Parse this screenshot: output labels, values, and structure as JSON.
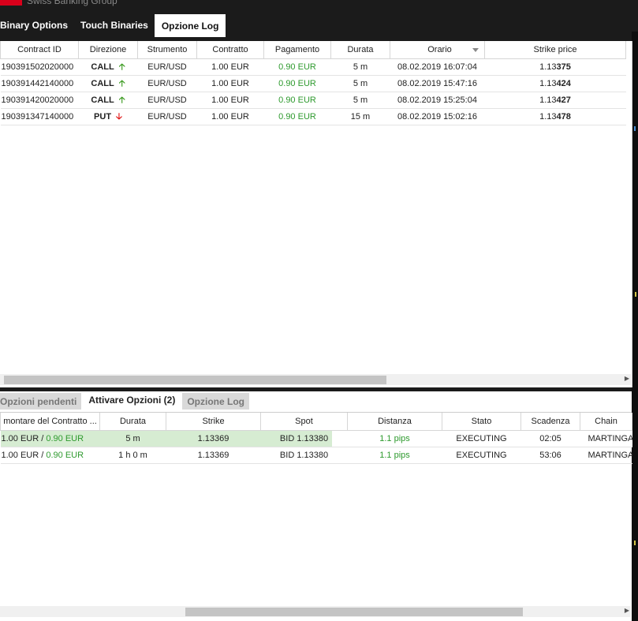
{
  "header": {
    "brand_text": "Swiss Banking Group",
    "tabs": [
      {
        "label": "Binary Options"
      },
      {
        "label": "Touch Binaries"
      },
      {
        "label": "Opzione Log"
      }
    ]
  },
  "log_table": {
    "columns": [
      "Contract ID",
      "Direzione",
      "Strumento",
      "Contratto",
      "Pagamento",
      "Durata",
      "Orario",
      "Strike price"
    ],
    "rows": [
      {
        "id": "190391502020000",
        "dir": "CALL",
        "instrument": "EUR/USD",
        "contract": "1.00 EUR",
        "payment": "0.90 EUR",
        "duration": "5 m",
        "time": "08.02.2019 16:07:04",
        "strike_a": "1.13",
        "strike_b": "375"
      },
      {
        "id": "190391442140000",
        "dir": "CALL",
        "instrument": "EUR/USD",
        "contract": "1.00 EUR",
        "payment": "0.90 EUR",
        "duration": "5 m",
        "time": "08.02.2019 15:47:16",
        "strike_a": "1.13",
        "strike_b": "424"
      },
      {
        "id": "190391420020000",
        "dir": "CALL",
        "instrument": "EUR/USD",
        "contract": "1.00 EUR",
        "payment": "0.90 EUR",
        "duration": "5 m",
        "time": "08.02.2019 15:25:04",
        "strike_a": "1.13",
        "strike_b": "427"
      },
      {
        "id": "190391347140000",
        "dir": "PUT",
        "instrument": "EUR/USD",
        "contract": "1.00 EUR",
        "payment": "0.90 EUR",
        "duration": "15 m",
        "time": "08.02.2019 15:02:16",
        "strike_a": "1.13",
        "strike_b": "478"
      }
    ]
  },
  "sub_tabs": [
    {
      "label": "Opzioni pendenti"
    },
    {
      "label": "Attivare Opzioni (2)"
    },
    {
      "label": "Opzione Log"
    }
  ],
  "active_table": {
    "columns": [
      "montare del Contratto ...",
      "Durata",
      "Strike",
      "Spot",
      "Distanza",
      "Stato",
      "Scadenza",
      "Chain"
    ],
    "rows": [
      {
        "amount": "1.00 EUR",
        "sep": " / ",
        "payout": "0.90 EUR",
        "duration": "5 m",
        "strike": "1.13369",
        "spot": "BID 1.13380",
        "distance": "1.1 pips",
        "state": "EXECUTING",
        "expiry": "02:05",
        "chain": "MARTINGA"
      },
      {
        "amount": "1.00 EUR",
        "sep": " / ",
        "payout": "0.90 EUR",
        "duration": "1 h 0 m",
        "strike": "1.13369",
        "spot": "BID 1.13380",
        "distance": "1.1 pips",
        "state": "EXECUTING",
        "expiry": "53:06",
        "chain": "MARTINGA"
      }
    ]
  },
  "colors": {
    "positive": "#2e9a2e",
    "up_arrow": "#3a9a1f",
    "down_arrow": "#e01010",
    "brand": "#d9001b",
    "highlight": "#d6ecd2"
  },
  "icons": {
    "up": "arrow-up-icon",
    "down": "arrow-down-icon"
  }
}
